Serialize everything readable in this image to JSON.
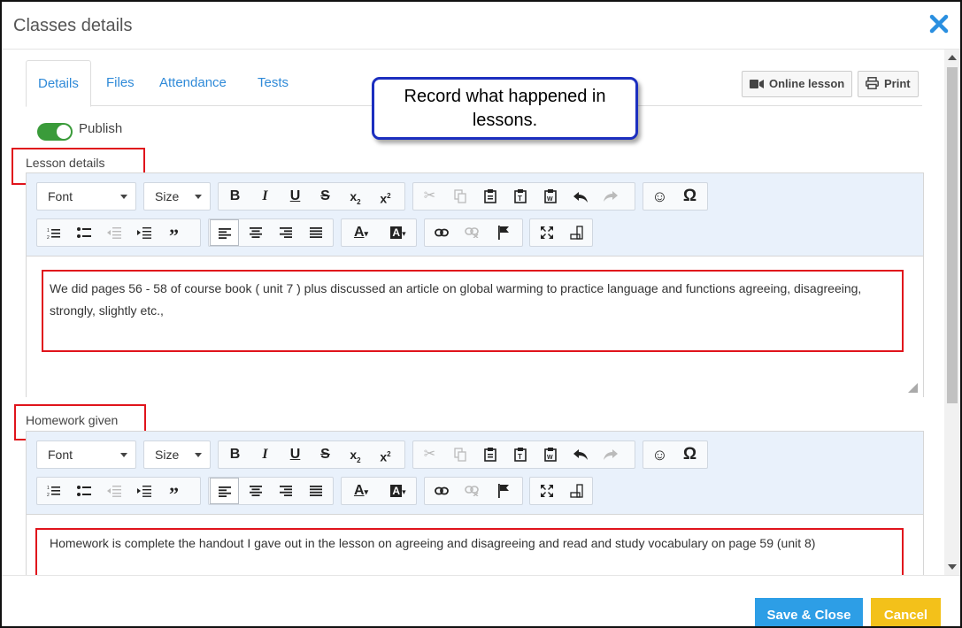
{
  "dialog": {
    "title": "Classes details"
  },
  "tabs": [
    {
      "label": "Details",
      "active": true
    },
    {
      "label": "Files",
      "active": false
    },
    {
      "label": "Attendance",
      "active": false
    },
    {
      "label": "Tests",
      "active": false
    }
  ],
  "toolbar": {
    "online_lesson_label": "Online lesson",
    "print_label": "Print"
  },
  "callout": {
    "text": "Record what happened in lessons."
  },
  "publish": {
    "label": "Publish",
    "on": true
  },
  "lesson_details": {
    "label": "Lesson details",
    "content": "We did pages 56 - 58 of course book ( unit 7 ) plus discussed an article on global warming to practice language and functions agreeing, disagreeing, strongly, slightly etc.,"
  },
  "homework": {
    "label": "Homework given",
    "content": "Homework is complete the handout I gave out in the lesson on agreeing and disagreeing and read and study vocabulary on page 59 (unit 8)"
  },
  "editor": {
    "font_label": "Font",
    "size_label": "Size"
  },
  "footer": {
    "save_label": "Save & Close",
    "cancel_label": "Cancel"
  },
  "colors": {
    "accent": "#2f8ad8",
    "save": "#2d9ee6",
    "cancel": "#f3c11a",
    "toggle_on": "#3a9b3a",
    "highlight_box": "#e0141c",
    "callout_border": "#1c2fbf"
  }
}
